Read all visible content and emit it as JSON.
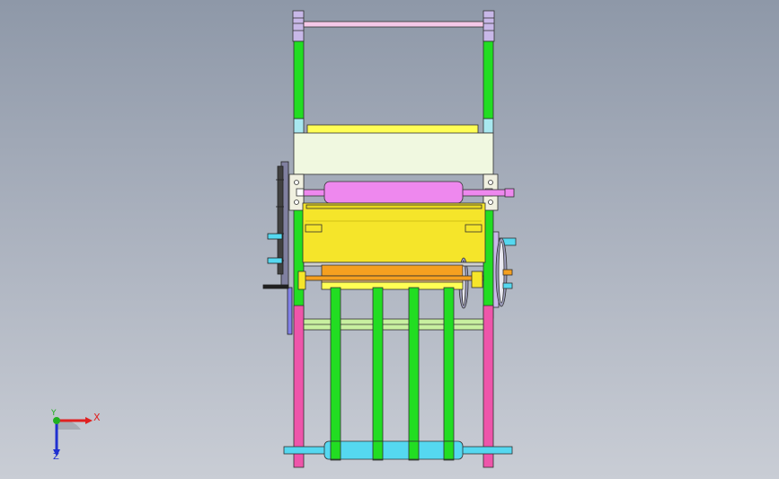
{
  "view": {
    "description_type": "cad-front-view",
    "background_top": "#8e98a8",
    "background_bottom": "#c9cdd5"
  },
  "triad": {
    "x_label": "X",
    "y_label": "Y",
    "z_label": "Z",
    "x_color": "#e02020",
    "y_color": "#20b020",
    "z_color": "#2030d0"
  },
  "colors": {
    "pink": "#ee55aa",
    "green": "#22dd22",
    "yellow": "#f5e52a",
    "light_yellow": "#ffff55",
    "pale": "#f0f8e0",
    "lavender": "#c8b8e8",
    "cyan": "#55d8f0",
    "magenta_roller": "#ee88ee",
    "orange": "#f5a020",
    "light_green": "#c8f0a0",
    "dark": "#202020"
  }
}
